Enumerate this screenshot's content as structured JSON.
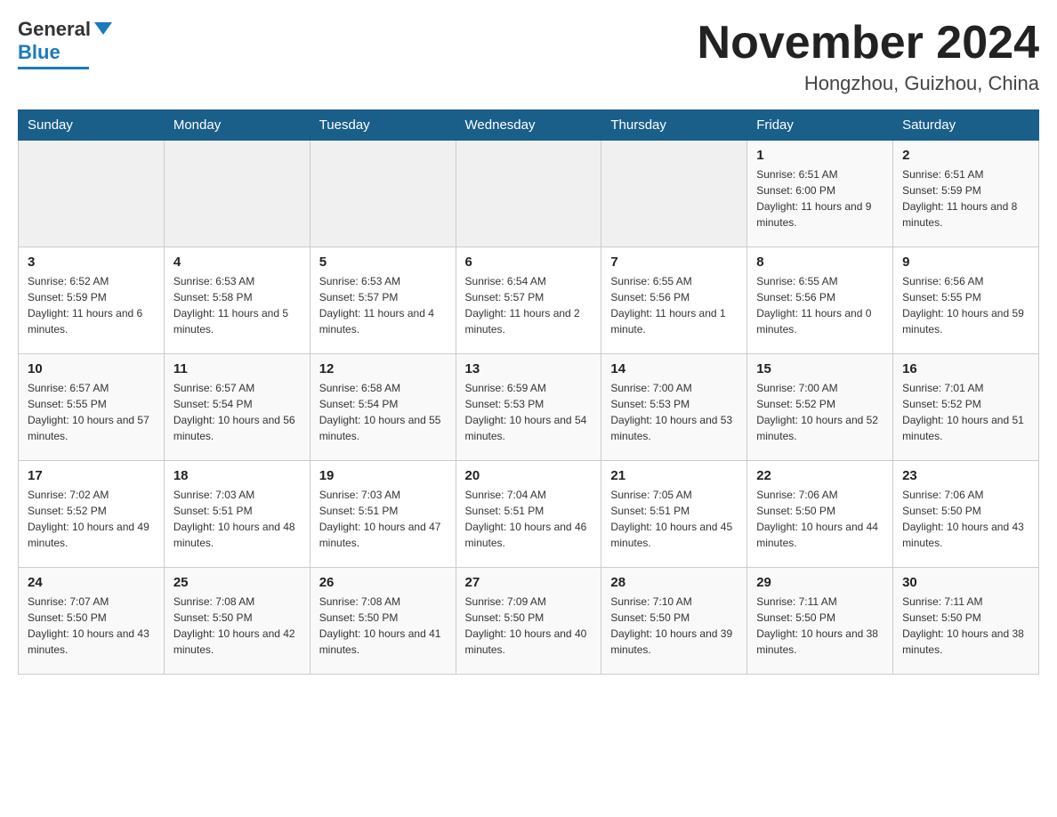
{
  "logo": {
    "brand": "General",
    "blue": "Blue"
  },
  "title": "November 2024",
  "location": "Hongzhou, Guizhou, China",
  "days_of_week": [
    "Sunday",
    "Monday",
    "Tuesday",
    "Wednesday",
    "Thursday",
    "Friday",
    "Saturday"
  ],
  "weeks": [
    [
      {
        "day": "",
        "info": ""
      },
      {
        "day": "",
        "info": ""
      },
      {
        "day": "",
        "info": ""
      },
      {
        "day": "",
        "info": ""
      },
      {
        "day": "",
        "info": ""
      },
      {
        "day": "1",
        "info": "Sunrise: 6:51 AM\nSunset: 6:00 PM\nDaylight: 11 hours and 9 minutes."
      },
      {
        "day": "2",
        "info": "Sunrise: 6:51 AM\nSunset: 5:59 PM\nDaylight: 11 hours and 8 minutes."
      }
    ],
    [
      {
        "day": "3",
        "info": "Sunrise: 6:52 AM\nSunset: 5:59 PM\nDaylight: 11 hours and 6 minutes."
      },
      {
        "day": "4",
        "info": "Sunrise: 6:53 AM\nSunset: 5:58 PM\nDaylight: 11 hours and 5 minutes."
      },
      {
        "day": "5",
        "info": "Sunrise: 6:53 AM\nSunset: 5:57 PM\nDaylight: 11 hours and 4 minutes."
      },
      {
        "day": "6",
        "info": "Sunrise: 6:54 AM\nSunset: 5:57 PM\nDaylight: 11 hours and 2 minutes."
      },
      {
        "day": "7",
        "info": "Sunrise: 6:55 AM\nSunset: 5:56 PM\nDaylight: 11 hours and 1 minute."
      },
      {
        "day": "8",
        "info": "Sunrise: 6:55 AM\nSunset: 5:56 PM\nDaylight: 11 hours and 0 minutes."
      },
      {
        "day": "9",
        "info": "Sunrise: 6:56 AM\nSunset: 5:55 PM\nDaylight: 10 hours and 59 minutes."
      }
    ],
    [
      {
        "day": "10",
        "info": "Sunrise: 6:57 AM\nSunset: 5:55 PM\nDaylight: 10 hours and 57 minutes."
      },
      {
        "day": "11",
        "info": "Sunrise: 6:57 AM\nSunset: 5:54 PM\nDaylight: 10 hours and 56 minutes."
      },
      {
        "day": "12",
        "info": "Sunrise: 6:58 AM\nSunset: 5:54 PM\nDaylight: 10 hours and 55 minutes."
      },
      {
        "day": "13",
        "info": "Sunrise: 6:59 AM\nSunset: 5:53 PM\nDaylight: 10 hours and 54 minutes."
      },
      {
        "day": "14",
        "info": "Sunrise: 7:00 AM\nSunset: 5:53 PM\nDaylight: 10 hours and 53 minutes."
      },
      {
        "day": "15",
        "info": "Sunrise: 7:00 AM\nSunset: 5:52 PM\nDaylight: 10 hours and 52 minutes."
      },
      {
        "day": "16",
        "info": "Sunrise: 7:01 AM\nSunset: 5:52 PM\nDaylight: 10 hours and 51 minutes."
      }
    ],
    [
      {
        "day": "17",
        "info": "Sunrise: 7:02 AM\nSunset: 5:52 PM\nDaylight: 10 hours and 49 minutes."
      },
      {
        "day": "18",
        "info": "Sunrise: 7:03 AM\nSunset: 5:51 PM\nDaylight: 10 hours and 48 minutes."
      },
      {
        "day": "19",
        "info": "Sunrise: 7:03 AM\nSunset: 5:51 PM\nDaylight: 10 hours and 47 minutes."
      },
      {
        "day": "20",
        "info": "Sunrise: 7:04 AM\nSunset: 5:51 PM\nDaylight: 10 hours and 46 minutes."
      },
      {
        "day": "21",
        "info": "Sunrise: 7:05 AM\nSunset: 5:51 PM\nDaylight: 10 hours and 45 minutes."
      },
      {
        "day": "22",
        "info": "Sunrise: 7:06 AM\nSunset: 5:50 PM\nDaylight: 10 hours and 44 minutes."
      },
      {
        "day": "23",
        "info": "Sunrise: 7:06 AM\nSunset: 5:50 PM\nDaylight: 10 hours and 43 minutes."
      }
    ],
    [
      {
        "day": "24",
        "info": "Sunrise: 7:07 AM\nSunset: 5:50 PM\nDaylight: 10 hours and 43 minutes."
      },
      {
        "day": "25",
        "info": "Sunrise: 7:08 AM\nSunset: 5:50 PM\nDaylight: 10 hours and 42 minutes."
      },
      {
        "day": "26",
        "info": "Sunrise: 7:08 AM\nSunset: 5:50 PM\nDaylight: 10 hours and 41 minutes."
      },
      {
        "day": "27",
        "info": "Sunrise: 7:09 AM\nSunset: 5:50 PM\nDaylight: 10 hours and 40 minutes."
      },
      {
        "day": "28",
        "info": "Sunrise: 7:10 AM\nSunset: 5:50 PM\nDaylight: 10 hours and 39 minutes."
      },
      {
        "day": "29",
        "info": "Sunrise: 7:11 AM\nSunset: 5:50 PM\nDaylight: 10 hours and 38 minutes."
      },
      {
        "day": "30",
        "info": "Sunrise: 7:11 AM\nSunset: 5:50 PM\nDaylight: 10 hours and 38 minutes."
      }
    ]
  ]
}
